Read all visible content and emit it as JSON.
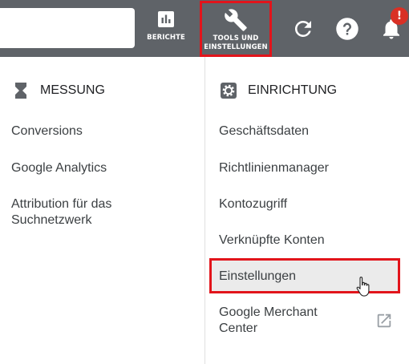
{
  "toolbar": {
    "reports_label": "BERICHTE",
    "tools_label": "TOOLS UND\nEINSTELLUNGEN",
    "notification_badge": "!",
    "accent_color": "#e2141b",
    "background_color": "#5f6368"
  },
  "left_section": {
    "title": "MESSUNG",
    "icon": "hourglass-icon",
    "items": [
      {
        "label": "Conversions"
      },
      {
        "label": "Google Analytics"
      },
      {
        "label": "Attribution für das\nSuchnetzwerk"
      }
    ]
  },
  "right_section": {
    "title": "EINRICHTUNG",
    "icon": "gear-icon",
    "items": [
      {
        "label": "Geschäftsdaten"
      },
      {
        "label": "Richtlinienmanager"
      },
      {
        "label": "Kontozugriff"
      },
      {
        "label": "Verknüpfte Konten"
      },
      {
        "label": "Einstellungen",
        "highlighted": true
      },
      {
        "label": "Google Merchant\nCenter",
        "icon": "external-link-icon"
      }
    ]
  }
}
